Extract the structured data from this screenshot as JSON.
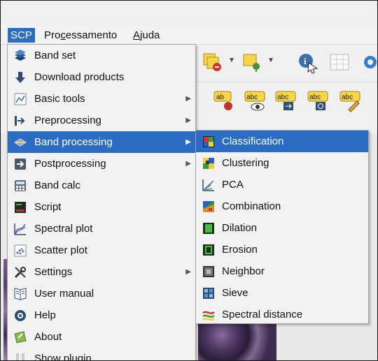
{
  "menubar": {
    "scp": "SCP",
    "processamento": "Processamento",
    "ajuda": "Ajuda"
  },
  "scp_menu": [
    {
      "label": "Band set",
      "icon": "band-set-icon",
      "submenu": false
    },
    {
      "label": "Download products",
      "icon": "download-icon",
      "submenu": false
    },
    {
      "label": "Basic tools",
      "icon": "basic-tools-icon",
      "submenu": true
    },
    {
      "label": "Preprocessing",
      "icon": "preprocessing-icon",
      "submenu": true
    },
    {
      "label": "Band processing",
      "icon": "band-processing-icon",
      "submenu": true,
      "selected": true
    },
    {
      "label": "Postprocessing",
      "icon": "postprocessing-icon",
      "submenu": true
    },
    {
      "label": "Band calc",
      "icon": "band-calc-icon",
      "submenu": false
    },
    {
      "label": "Script",
      "icon": "script-icon",
      "submenu": false
    },
    {
      "label": "Spectral plot",
      "icon": "spectral-plot-icon",
      "submenu": false
    },
    {
      "label": "Scatter plot",
      "icon": "scatter-plot-icon",
      "submenu": false
    },
    {
      "label": "Settings",
      "icon": "settings-icon",
      "submenu": true
    },
    {
      "label": "User manual",
      "icon": "user-manual-icon",
      "submenu": false
    },
    {
      "label": "Help",
      "icon": "help-icon",
      "submenu": false
    },
    {
      "label": "About",
      "icon": "about-icon",
      "submenu": false
    },
    {
      "label": "Show plugin",
      "icon": "show-plugin-icon",
      "submenu": false
    }
  ],
  "band_processing_menu": [
    {
      "label": "Classification",
      "icon": "classification-icon",
      "selected": true
    },
    {
      "label": "Clustering",
      "icon": "clustering-icon"
    },
    {
      "label": "PCA",
      "icon": "pca-icon"
    },
    {
      "label": "Combination",
      "icon": "combination-icon"
    },
    {
      "label": "Dilation",
      "icon": "dilation-icon"
    },
    {
      "label": "Erosion",
      "icon": "erosion-icon"
    },
    {
      "label": "Neighbor",
      "icon": "neighbor-icon"
    },
    {
      "label": "Sieve",
      "icon": "sieve-icon"
    },
    {
      "label": "Spectral distance",
      "icon": "spectral-distance-icon"
    }
  ],
  "colors": {
    "selection": "#2b6cc4",
    "menu_bg": "#f2f2f2"
  }
}
